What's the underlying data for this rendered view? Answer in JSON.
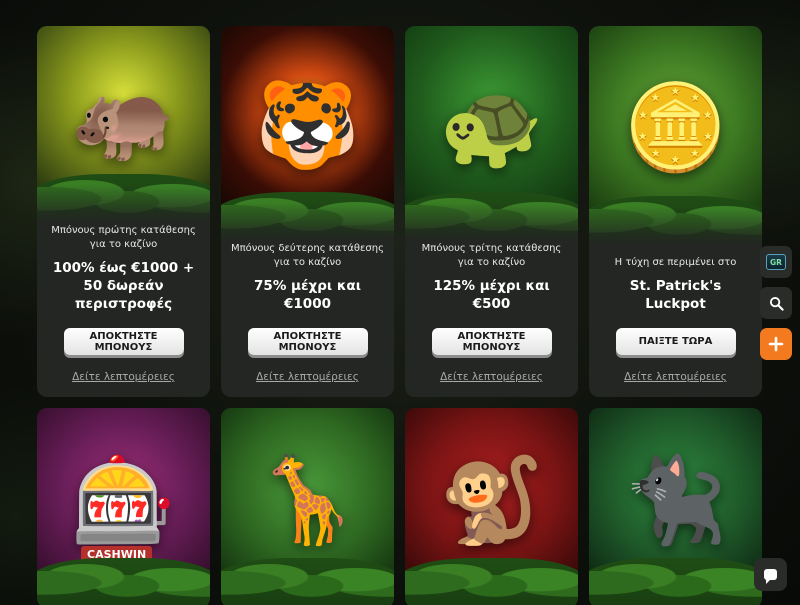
{
  "promos": [
    {
      "subtitle": "Μπόνους πρώτης κατάθεσης για το καζίνο",
      "title": "100% έως €1000 + 50 δωρεάν περιστροφές",
      "button": "ΑΠΟΚΤΗΣΤΕ ΜΠΟΝΟΥΣ",
      "details": "Δείτε λεπτομέρειες",
      "mascot_icon": "hippo-icon",
      "mascot_glyph": "🦛",
      "accent": "#8a9a1c"
    },
    {
      "subtitle": "Μπόνους δεύτερης κατάθεσης για το καζίνο",
      "title": "75% μέχρι και €1000",
      "button": "ΑΠΟΚΤΗΣΤΕ ΜΠΟΝΟΥΣ",
      "details": "Δείτε λεπτομέρειες",
      "mascot_icon": "tiger-icon",
      "mascot_glyph": "🐯",
      "accent": "#d24a12"
    },
    {
      "subtitle": "Μπόνους τρίτης κατάθεσης για το καζίνο",
      "title": "125% μέχρι και €500",
      "button": "ΑΠΟΚΤΗΣΤΕ ΜΠΟΝΟΥΣ",
      "details": "Δείτε λεπτομέρειες",
      "mascot_icon": "turtle-icon",
      "mascot_glyph": "🐢",
      "accent": "#2f7a2a"
    },
    {
      "subtitle": "Η τύχη σε περιμένει στο",
      "title": "St. Patrick's Luckpot",
      "button": "ΠΑΙΞΤΕ ΤΩΡΑ",
      "details": "Δείτε λεπτομέρειες",
      "mascot_icon": "gold-coins-icon",
      "mascot_glyph": "🪙",
      "accent": "#3d7a22"
    }
  ],
  "games": [
    {
      "icon": "slot-machine-icon",
      "glyph": "🎰",
      "label": "CASHWIN",
      "accent": "#6b1f5a"
    },
    {
      "icon": "giraffe-icon",
      "glyph": "🦒",
      "accent": "#2f6a22"
    },
    {
      "icon": "monkey-icon",
      "glyph": "🐒",
      "accent": "#7a1414"
    },
    {
      "icon": "panther-icon",
      "glyph": "🐈‍⬛",
      "accent": "#1f5a2a"
    }
  ],
  "sidebar": {
    "language": "GR",
    "search_icon": "search-icon",
    "add_icon": "plus-icon"
  },
  "chat_icon": "chat-icon"
}
